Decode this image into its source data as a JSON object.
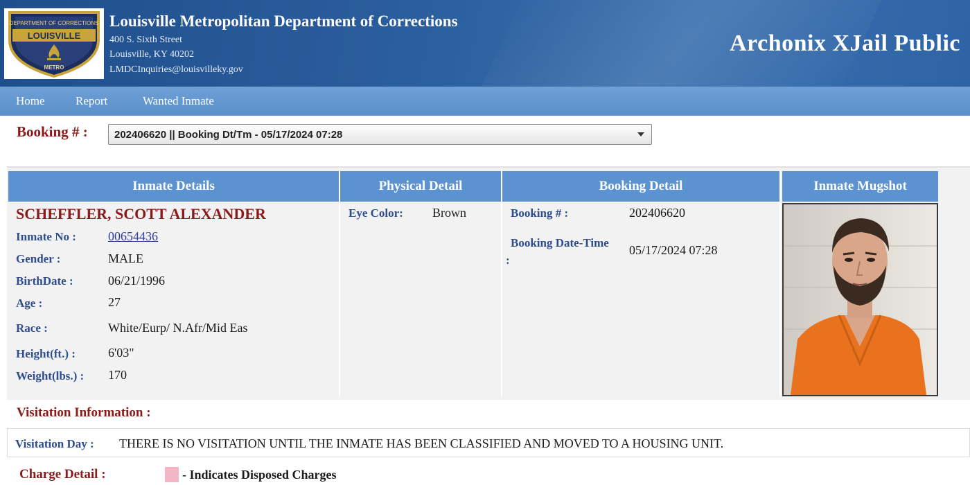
{
  "header": {
    "department": "Louisville Metropolitan Department of Corrections",
    "address_line1": "400 S. Sixth Street",
    "address_line2": "Louisville, KY 40202",
    "email": "LMDCInquiries@louisvilleky.gov",
    "app_title": "Archonix XJail Public",
    "logo": {
      "top_text": "DEPARTMENT OF CORRECTIONS",
      "band_text": "LOUISVILLE",
      "bottom_text": "METRO"
    }
  },
  "nav": {
    "items": [
      {
        "label": "Home"
      },
      {
        "label": "Report"
      },
      {
        "label": "Wanted Inmate"
      }
    ]
  },
  "booking_select": {
    "label": "Booking # :",
    "selected": "202406620 || Booking Dt/Tm - 05/17/2024 07:28"
  },
  "sections": {
    "inmate_details": "Inmate Details",
    "physical_detail": "Physical Detail",
    "booking_detail": "Booking Detail",
    "inmate_mugshot": "Inmate Mugshot"
  },
  "inmate": {
    "name": "SCHEFFLER, SCOTT ALEXANDER",
    "fields": [
      {
        "label": "Inmate No :",
        "value": "00654436"
      },
      {
        "label": "Gender :",
        "value": "MALE"
      },
      {
        "label": "BirthDate :",
        "value": "06/21/1996"
      },
      {
        "label": "Age :",
        "value": "27"
      },
      {
        "label": "Race :",
        "value": "White/Eurp/ N.Afr/Mid Eas"
      },
      {
        "label": "Height(ft.) :",
        "value": "6'03\""
      },
      {
        "label": "Weight(lbs.) :",
        "value": "170"
      }
    ]
  },
  "physical": {
    "eye_color_label": "Eye Color:",
    "eye_color_value": "Brown"
  },
  "booking": {
    "number_label": "Booking # :",
    "number_value": "202406620",
    "datetime_label": "Booking Date-Time",
    "datetime_colon": ":",
    "datetime_value": "05/17/2024 07:28"
  },
  "visitation": {
    "title": "Visitation Information :",
    "day_label": "Visitation Day :",
    "day_value": "THERE IS NO VISITATION UNTIL THE INMATE HAS BEEN CLASSIFIED AND MOVED TO A HOUSING UNIT."
  },
  "charges": {
    "title": "Charge Detail :",
    "legend_text": "- Indicates Disposed Charges",
    "legend_color": "#f4b6c2"
  },
  "colors": {
    "header_blue": "#2c5f9e",
    "nav_blue": "#5a8fcb",
    "section_blue": "#5b92cf",
    "title_red": "#8b1a1a",
    "label_blue": "#2e4d8f"
  }
}
